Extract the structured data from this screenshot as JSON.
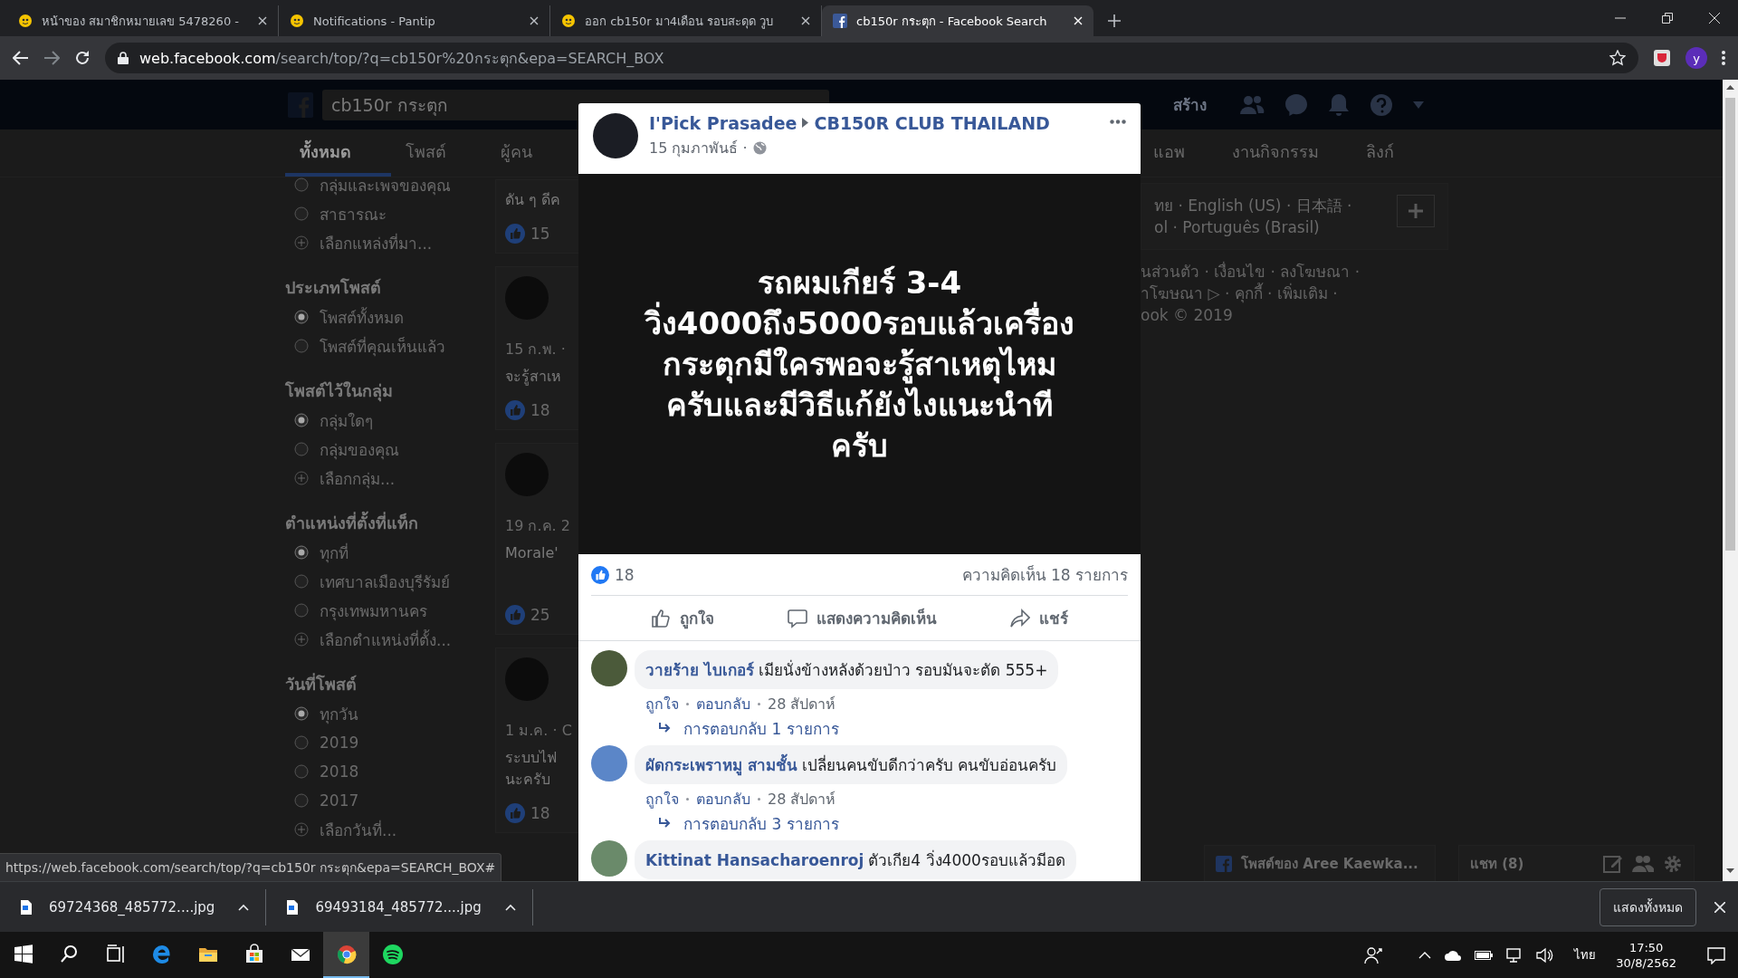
{
  "browser": {
    "tabs": [
      {
        "title": "หน้าของ สมาชิกหมายเลข 5478260 -",
        "kind": "pantip",
        "selected": false
      },
      {
        "title": "Notifications - Pantip",
        "kind": "pantip",
        "selected": false
      },
      {
        "title": "ออก cb150r มา4เดือน รอบสะดุด วูบ",
        "kind": "pantip",
        "selected": false
      },
      {
        "title": "cb150r กระตุก - Facebook Search",
        "kind": "facebook",
        "selected": true
      }
    ],
    "url_host": "web.facebook.com",
    "url_path": "/search/top/?q=cb150r%20กระตุก&epa=SEARCH_BOX",
    "profile_initial": "y"
  },
  "facebook": {
    "search": {
      "value": "cb150r กระตุก"
    },
    "create_link": "สร้าง",
    "nav_tabs": [
      {
        "label": "ทั้งหมด",
        "selected": true
      },
      {
        "label": "โพสต์",
        "selected": false
      },
      {
        "label": "ผู้คน",
        "selected": false
      },
      {
        "label": "แอพ",
        "selected": false
      },
      {
        "label": "งานกิจกรรม",
        "selected": false
      },
      {
        "label": "ลิงก์",
        "selected": false
      }
    ],
    "filters": [
      {
        "items": [
          {
            "label": "กลุ่มและเพจของคุณ",
            "kind": "radio",
            "selected": false
          },
          {
            "label": "สาธารณะ",
            "kind": "radio",
            "selected": false
          },
          {
            "label": "เลือกแหล่งที่มา...",
            "kind": "add"
          }
        ]
      },
      {
        "heading": "ประเภทโพสต์",
        "items": [
          {
            "label": "โพสต์ทั้งหมด",
            "kind": "radio",
            "selected": true
          },
          {
            "label": "โพสต์ที่คุณเห็นแล้ว",
            "kind": "radio",
            "selected": false
          }
        ]
      },
      {
        "heading": "โพสต์ไว้ในกลุ่ม",
        "items": [
          {
            "label": "กลุ่มใดๆ",
            "kind": "radio",
            "selected": true
          },
          {
            "label": "กลุ่มของคุณ",
            "kind": "radio",
            "selected": false
          },
          {
            "label": "เลือกกลุ่ม...",
            "kind": "add"
          }
        ]
      },
      {
        "heading": "ตำแหน่งที่ตั้งที่แท็ก",
        "items": [
          {
            "label": "ทุกที่",
            "kind": "radio",
            "selected": true
          },
          {
            "label": "เทศบาลเมืองบุรีรัมย์",
            "kind": "radio",
            "selected": false
          },
          {
            "label": "กรุงเทพมหานคร",
            "kind": "radio",
            "selected": false
          },
          {
            "label": "เลือกตำแหน่งที่ตั้ง...",
            "kind": "add"
          }
        ]
      },
      {
        "heading": "วันที่โพสต์",
        "items": [
          {
            "label": "ทุกวัน",
            "kind": "radio",
            "selected": true
          },
          {
            "label": "2019",
            "kind": "radio",
            "selected": false
          },
          {
            "label": "2018",
            "kind": "radio",
            "selected": false
          },
          {
            "label": "2017",
            "kind": "radio",
            "selected": false
          },
          {
            "label": "เลือกวันที่...",
            "kind": "add"
          }
        ]
      }
    ],
    "results": [
      {
        "lines": [
          "ดัน ๆ ดีค"
        ],
        "likes": "15"
      },
      {
        "date": "15 ก.พ. ·",
        "lines": [
          "จะรู้สาเห"
        ],
        "likes": "18"
      },
      {
        "date": "19 ก.ค. 2",
        "lines": [
          "Morale'"
        ],
        "likes": "25"
      },
      {
        "date": "1 ม.ค. · C",
        "lines": [
          "ระบบไฟ",
          "นะครับ"
        ],
        "likes": "18"
      }
    ],
    "languages": [
      "ทย · English (US) · 日本語 ·",
      "ol · Português (Brasil)"
    ],
    "footer_lines": [
      "นส่วนตัว · เงื่อนไข · ลงโฆษณา ·",
      "าโฆษณา ▷ · คุกกี้ · เพิ่มเติม ·",
      "ook © 2019"
    ],
    "page_chat": "โพสต์ของ Aree Kaewka...",
    "chat": "แชท (8)"
  },
  "post": {
    "author": "I'Pick Prasadee",
    "group": "CB150R CLUB THAILAND",
    "date": "15 กุมภาพันธ์ ·",
    "text_lines": [
      "รถผมเกียร์ 3-4",
      "วิ่ง4000ถึง5000รอบแล้วเครื่อง",
      "กระตุกมีใครพอจะรู้สาเหตุไหม",
      "ครับและมีวิธีแก้ยังไงแนะนำที",
      "ครับ"
    ],
    "likes": "18",
    "comment_count": "ความคิดเห็น 18 รายการ",
    "actions": [
      {
        "label": "ถูกใจ",
        "kind": "like"
      },
      {
        "label": "แสดงความคิดเห็น",
        "kind": "comment"
      },
      {
        "label": "แชร์",
        "kind": "share"
      }
    ],
    "comments": [
      {
        "author": "วายร้าย ไบเกอร์",
        "text": "เมียนั่งข้างหลังด้วยป่าว รอบมันจะตัด 555+",
        "like": "ถูกใจ",
        "reply": "ตอบกลับ",
        "time": "28 สัปดาห์",
        "replies": "การตอบกลับ 1 รายการ"
      },
      {
        "author": "ผัดกระเพราหมู สามชั้น",
        "text": "เปลี่ยนคนขับดีกว่าครับ คนขับอ่อนครับ",
        "like": "ถูกใจ",
        "reply": "ตอบกลับ",
        "time": "28 สัปดาห์",
        "replies": "การตอบกลับ 3 รายการ"
      },
      {
        "author": "Kittinat Hansacharoenroj",
        "text": "ตัวเกีย4 วิ่ง4000รอบแล้วมีอด"
      }
    ]
  },
  "status_url": "https://web.facebook.com/search/top/?q=cb150r กระตุก&epa=SEARCH_BOX#",
  "downloads": {
    "files": [
      "69724368_485772....jpg",
      "69493184_485772....jpg"
    ],
    "show_all": "แสดงทั้งหมด"
  },
  "taskbar": {
    "apps": [
      {
        "kind": "windows",
        "selected": false
      },
      {
        "kind": "search",
        "selected": false
      },
      {
        "kind": "taskview",
        "selected": false
      },
      {
        "kind": "edge",
        "selected": false
      },
      {
        "kind": "explorer",
        "selected": false
      },
      {
        "kind": "store",
        "selected": false
      },
      {
        "kind": "mail",
        "selected": false
      },
      {
        "kind": "chrome",
        "selected": true
      },
      {
        "kind": "spotify",
        "selected": false
      }
    ],
    "language": "ไทย",
    "time": "17:50",
    "date": "30/8/2562"
  }
}
